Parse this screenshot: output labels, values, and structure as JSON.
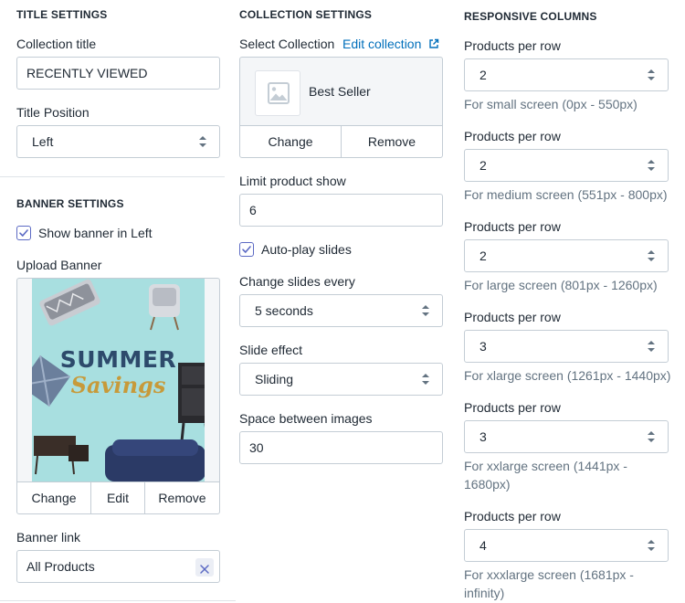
{
  "title_settings": {
    "heading": "TITLE SETTINGS",
    "collection_title_label": "Collection title",
    "collection_title_value": "RECENTLY VIEWED",
    "title_position_label": "Title Position",
    "title_position_value": "Left"
  },
  "banner_settings": {
    "heading": "BANNER SETTINGS",
    "show_banner_label": "Show banner in Left",
    "show_banner_checked": true,
    "upload_banner_label": "Upload Banner",
    "banner_image": {
      "line1": "SUMMER",
      "line2": "Savings"
    },
    "buttons": {
      "change": "Change",
      "edit": "Edit",
      "remove": "Remove"
    },
    "banner_link_label": "Banner link",
    "banner_link_value": "All Products"
  },
  "collection_settings": {
    "heading": "COLLECTION SETTINGS",
    "select_collection_label": "Select Collection",
    "edit_collection_link": "Edit collection",
    "collection_name": "Best Seller",
    "buttons": {
      "change": "Change",
      "remove": "Remove"
    },
    "limit_label": "Limit product show",
    "limit_value": "6",
    "autoplay_label": "Auto-play slides",
    "autoplay_checked": true,
    "change_slides_label": "Change slides every",
    "change_slides_value": "5 seconds",
    "slide_effect_label": "Slide effect",
    "slide_effect_value": "Sliding",
    "space_label": "Space between images",
    "space_value": "30"
  },
  "responsive_columns": {
    "heading": "RESPONSIVE COLUMNS",
    "rows": [
      {
        "label": "Products per row",
        "value": "2",
        "help": "For small screen (0px - 550px)"
      },
      {
        "label": "Products per row",
        "value": "2",
        "help": "For medium screen (551px - 800px)"
      },
      {
        "label": "Products per row",
        "value": "2",
        "help": "For large screen (801px - 1260px)"
      },
      {
        "label": "Products per row",
        "value": "3",
        "help": "For xlarge screen (1261px - 1440px)"
      },
      {
        "label": "Products per row",
        "value": "3",
        "help_line1": "For xxlarge screen (1441px -",
        "help_line2": "1680px)"
      },
      {
        "label": "Products per row",
        "value": "4",
        "help_line1": "For xxxlarge screen (1681px -",
        "help_line2": "infinity)"
      }
    ]
  },
  "colors": {
    "accent": "#5c6ac4",
    "link": "#006fbb",
    "border": "#c4cdd5",
    "banner_bg": "#a8dfe0",
    "summer_text": "#2d4a6b",
    "savings_text": "#c79a3a"
  }
}
